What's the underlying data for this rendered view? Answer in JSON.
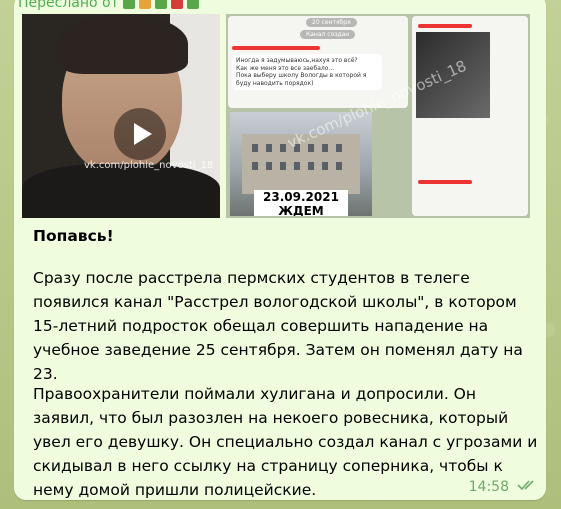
{
  "forwarded_label": "Переслано от",
  "video": {
    "watermark": "vk.com/plohie_novosti_18"
  },
  "collage": {
    "date_chip": "20 сентября",
    "channel_chip": "Канал создан",
    "msg1": "Иногда я задумываюсь,нахуя это всё?\nКак же меня это все заебало...\nПока выберу школу Вологды в которой я буду наводить порядок)",
    "stamp_date": "23.09.2021",
    "stamp_word": "ЖДЕМ",
    "watermark": "vk.com/plohie_novosti_18"
  },
  "message": {
    "title": "Попавсь!",
    "paragraph1": "Сразу после расстрела пермских студентов в телеге появился канал \"Расстрел вологодской школы\", в котором 15-летний подросток обещал совершить нападение на учебное заведение 25 сентября. Затем он поменял дату на 23.",
    "paragraph2": "Правоохранители поймали хулигана и допросили. Он заявил, что был разозлен на некоего ровесника, который увел его девушку. Он специально создал канал с угрозами и скидывал в него ссылку на страницу соперника, чтобы к нему домой пришли полицейские.",
    "time": "14:58"
  },
  "colors": {
    "bubble": "#effdde",
    "meta": "#6fa96c",
    "forwarded": "#4fae4e"
  }
}
